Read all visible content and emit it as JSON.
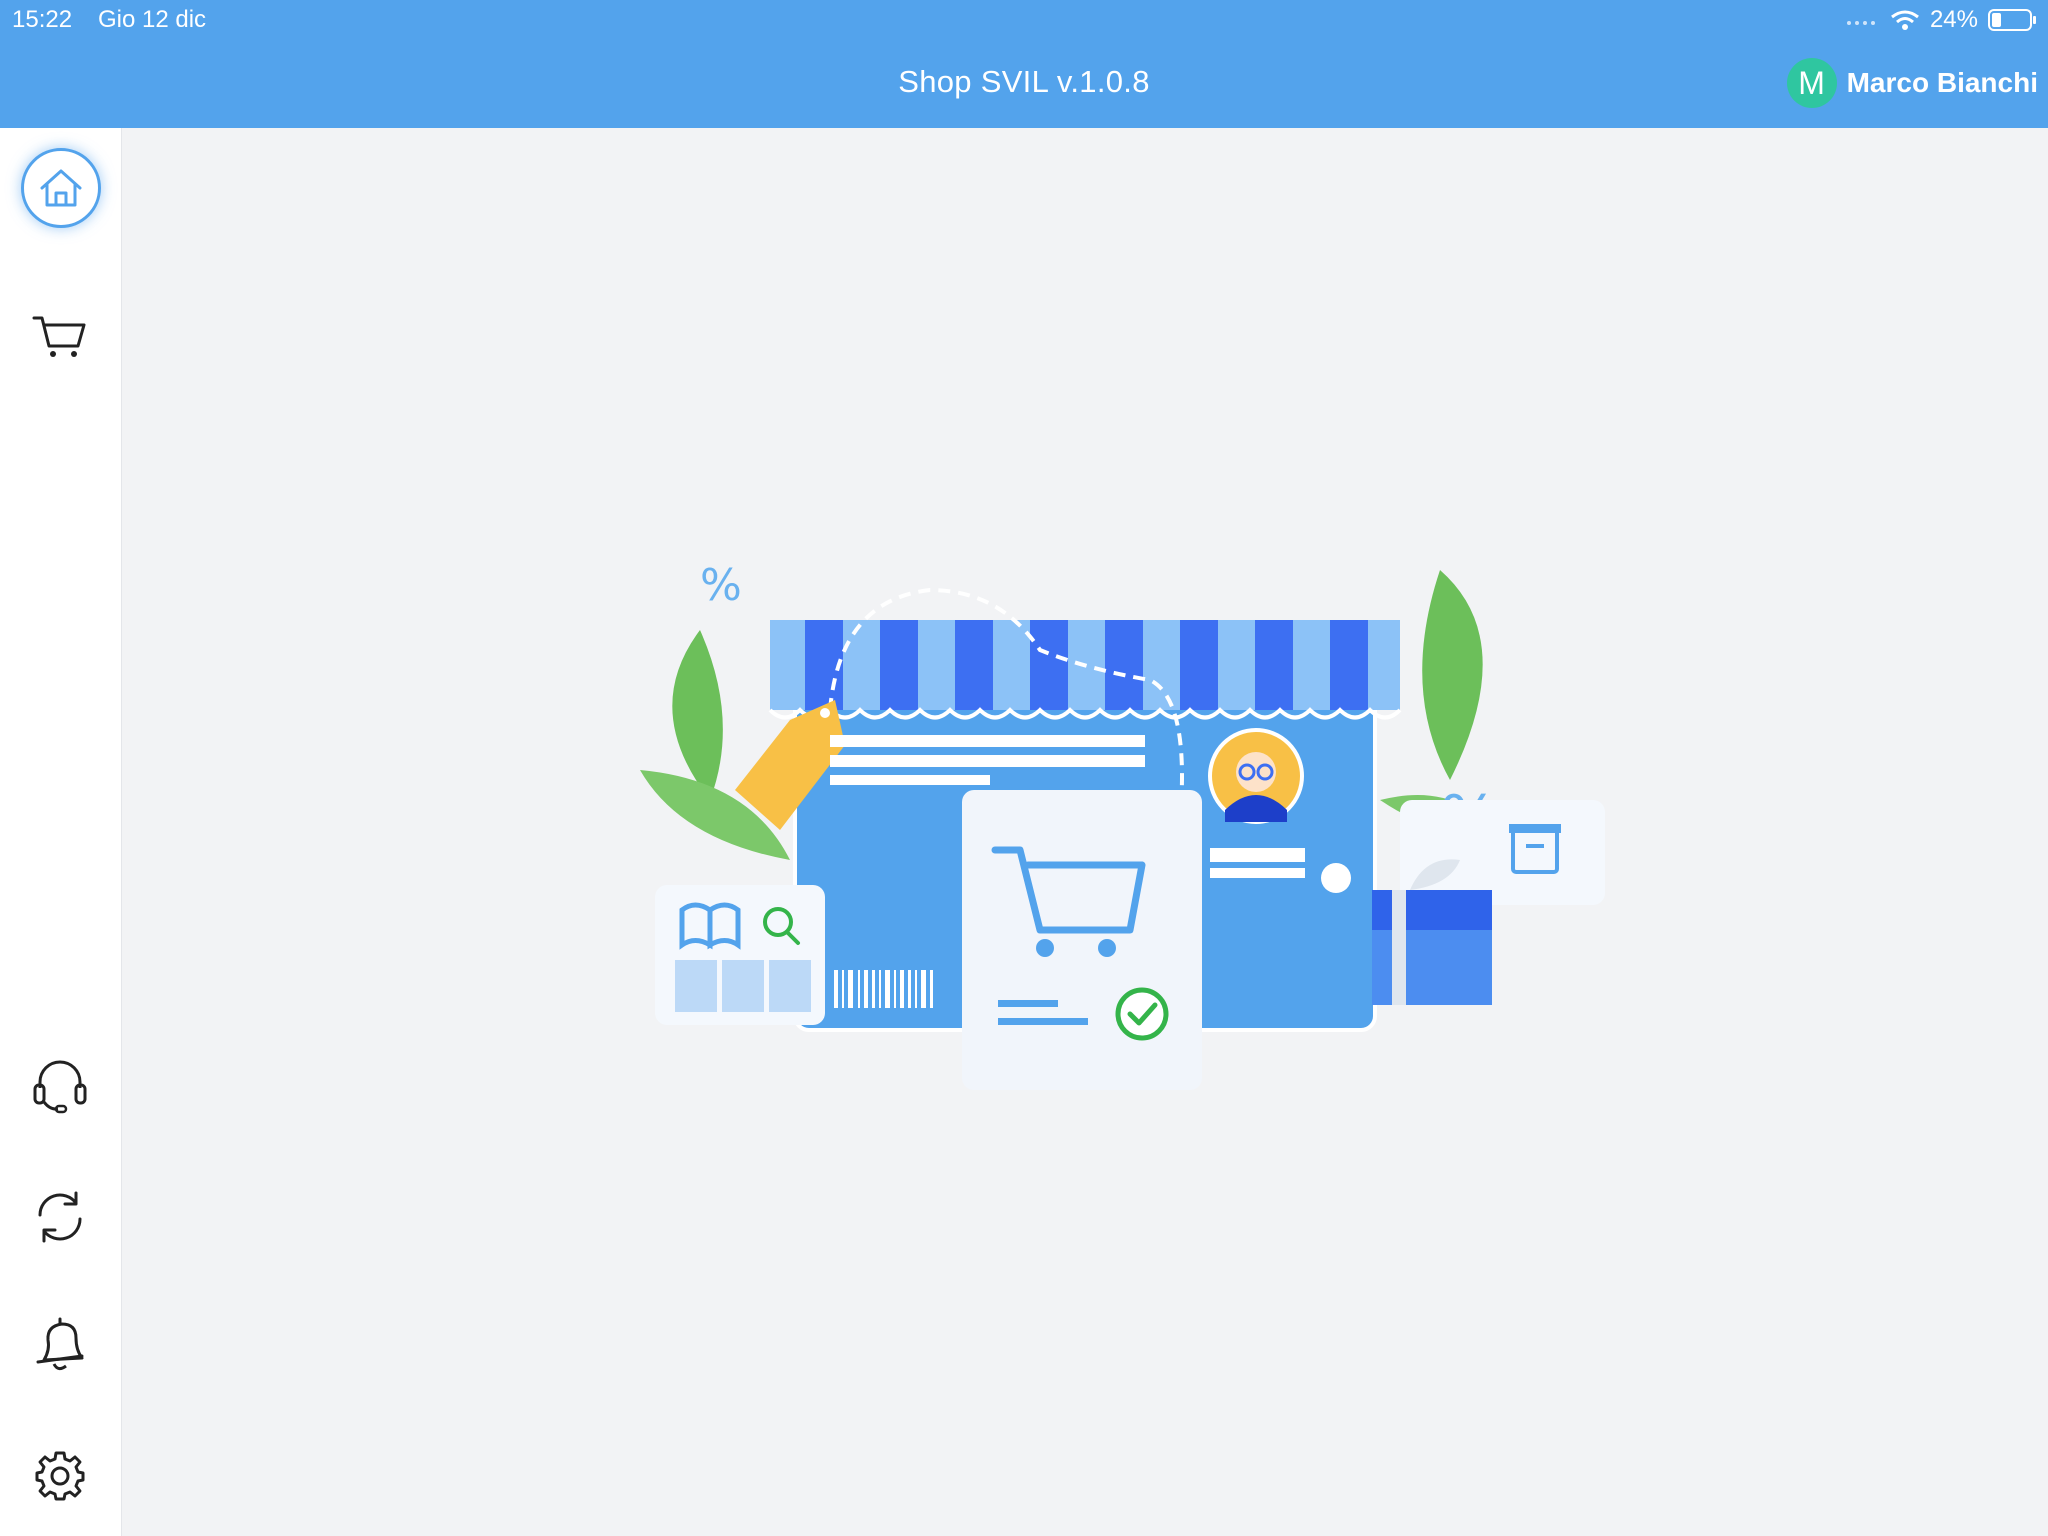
{
  "status_bar": {
    "time": "15:22",
    "date": "Gio 12 dic",
    "battery": "24%"
  },
  "header": {
    "title": "Shop SVIL v.1.0.8",
    "user_initial": "M",
    "user_name": "Marco Bianchi"
  },
  "sidebar": {
    "items": [
      {
        "icon": "home-icon",
        "active": true
      },
      {
        "icon": "cart-icon",
        "active": false
      },
      {
        "icon": "headset-icon",
        "active": false
      },
      {
        "icon": "sync-icon",
        "active": false
      },
      {
        "icon": "bell-icon",
        "active": false
      },
      {
        "icon": "gear-icon",
        "active": false
      }
    ]
  },
  "colors": {
    "primary": "#53a3ec",
    "avatar": "#2fc6a0",
    "background": "#f2f3f5"
  }
}
